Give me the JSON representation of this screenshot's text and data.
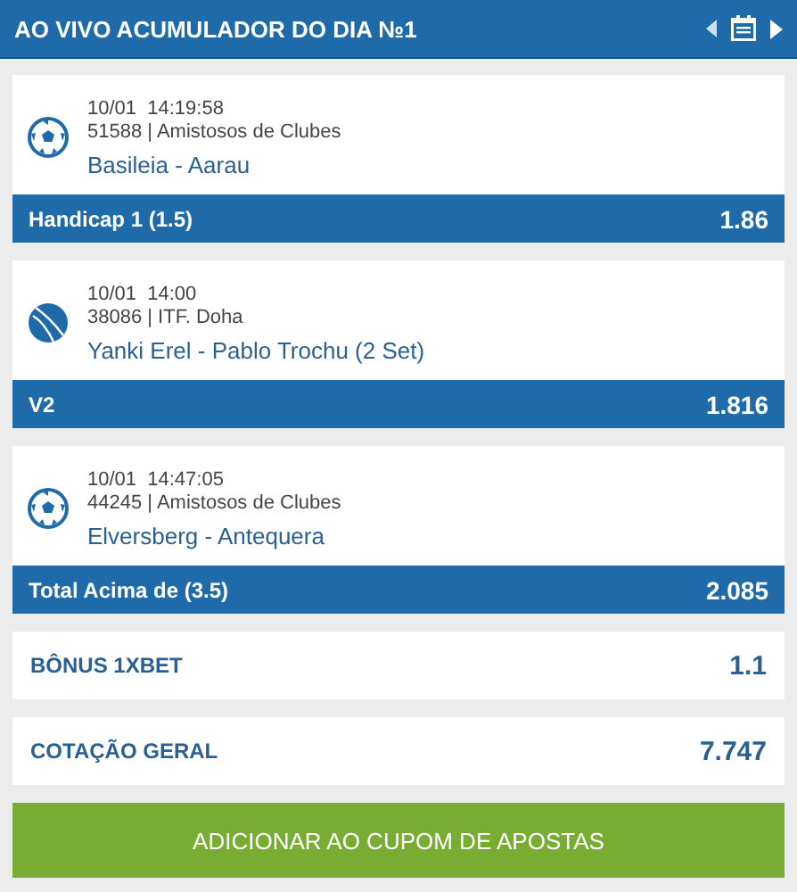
{
  "header": {
    "title": "AO VIVO ACUMULADOR DO DIA №1"
  },
  "events": [
    {
      "kind": "football",
      "date": "10/01",
      "time": "14:19:58",
      "league": "51588 | Amistosos de Clubes",
      "teams": "Basileia - Aarau",
      "bet": "Handicap 1 (1.5)",
      "odds": "1.86"
    },
    {
      "kind": "tennis",
      "date": "10/01",
      "time": "14:00",
      "league": "38086 | ITF. Doha",
      "teams": "Yanki Erel - Pablo Trochu (2 Set)",
      "bet": "V2",
      "odds": "1.816"
    },
    {
      "kind": "football",
      "date": "10/01",
      "time": "14:47:05",
      "league": "44245 | Amistosos de Clubes",
      "teams": "Elversberg - Antequera",
      "bet": "Total Acima de (3.5)",
      "odds": "2.085"
    }
  ],
  "summary": [
    {
      "label": "BÔNUS 1XBET",
      "value": "1.1"
    },
    {
      "label": "COTAÇÃO GERAL",
      "value": "7.747"
    }
  ],
  "add_button": "ADICIONAR AO CUPOM DE APOSTAS"
}
